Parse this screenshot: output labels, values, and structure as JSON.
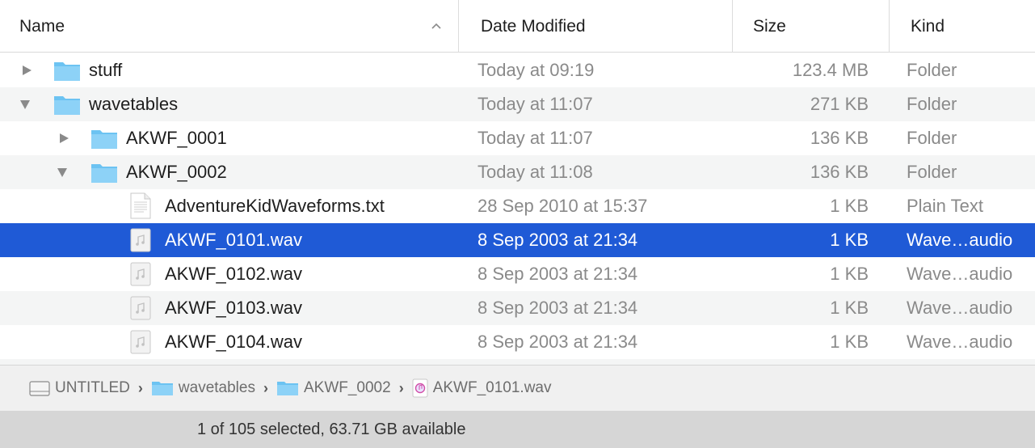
{
  "columns": {
    "name": "Name",
    "date_modified": "Date Modified",
    "size": "Size",
    "kind": "Kind"
  },
  "rows": [
    {
      "name": "stuff",
      "date": "Today at 09:19",
      "size": "123.4 MB",
      "kind": "Folder",
      "type": "folder",
      "expanded": false,
      "depth": 0
    },
    {
      "name": "wavetables",
      "date": "Today at 11:07",
      "size": "271 KB",
      "kind": "Folder",
      "type": "folder",
      "expanded": true,
      "depth": 0
    },
    {
      "name": "AKWF_0001",
      "date": "Today at 11:07",
      "size": "136 KB",
      "kind": "Folder",
      "type": "folder",
      "expanded": false,
      "depth": 1
    },
    {
      "name": "AKWF_0002",
      "date": "Today at 11:08",
      "size": "136 KB",
      "kind": "Folder",
      "type": "folder",
      "expanded": true,
      "depth": 1
    },
    {
      "name": "AdventureKidWaveforms.txt",
      "date": "28 Sep 2010 at 15:37",
      "size": "1 KB",
      "kind": "Plain Text",
      "type": "text",
      "depth": 2
    },
    {
      "name": "AKWF_0101.wav",
      "date": "8 Sep 2003 at 21:34",
      "size": "1 KB",
      "kind": "Wave…audio",
      "type": "audio",
      "selected": true,
      "depth": 2
    },
    {
      "name": "AKWF_0102.wav",
      "date": "8 Sep 2003 at 21:34",
      "size": "1 KB",
      "kind": "Wave…audio",
      "type": "audio",
      "depth": 2
    },
    {
      "name": "AKWF_0103.wav",
      "date": "8 Sep 2003 at 21:34",
      "size": "1 KB",
      "kind": "Wave…audio",
      "type": "audio",
      "depth": 2
    },
    {
      "name": "AKWF_0104.wav",
      "date": "8 Sep 2003 at 21:34",
      "size": "1 KB",
      "kind": "Wave…audio",
      "type": "audio",
      "depth": 2
    }
  ],
  "pathbar": {
    "volume": "UNTITLED",
    "folder1": "wavetables",
    "folder2": "AKWF_0002",
    "file": "AKWF_0101.wav",
    "separator": "›"
  },
  "status": "1 of 105 selected, 63.71 GB available",
  "colors": {
    "selection": "#1f5ad6",
    "folder": "#6cc3f2",
    "alt_row": "#f4f5f5"
  },
  "icons": {
    "folder": "folder-icon",
    "text": "text-file-icon",
    "audio": "audio-file-icon",
    "volume": "drive-icon"
  }
}
